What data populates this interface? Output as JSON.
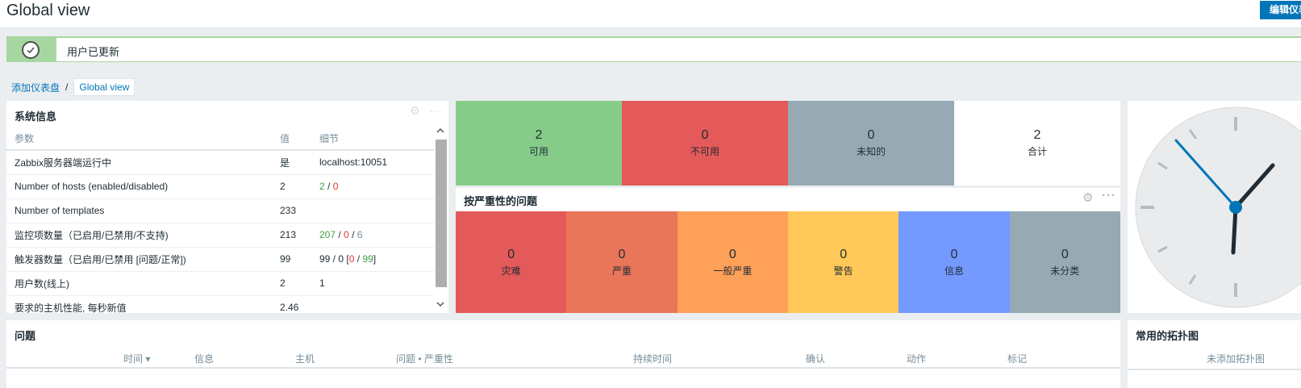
{
  "header": {
    "title": "Global view",
    "edit_button": "编辑仪表盘"
  },
  "message": {
    "text": "用户已更新",
    "icon": "check-icon"
  },
  "breadcrumb": {
    "parent": "添加仪表盘",
    "separator": "/",
    "current": "Global view"
  },
  "system_info": {
    "title": "系统信息",
    "columns": [
      "参数",
      "值",
      "细节"
    ],
    "rows": [
      {
        "param": "Zabbix服务器端运行中",
        "value": "是",
        "detail": "localhost:10051"
      },
      {
        "param": "Number of hosts (enabled/disabled)",
        "value": "2",
        "d1": "2",
        "d2": "0"
      },
      {
        "param": "Number of templates",
        "value": "233",
        "detail": ""
      },
      {
        "param": "监控项数量（已启用/已禁用/不支持)",
        "value": "213",
        "d1": "207",
        "d2": "0",
        "d3": "6"
      },
      {
        "param": "触发器数量（已启用/已禁用 [问题/正常])",
        "value": "99",
        "d_prefix": "99 / 0 [",
        "d1": "0",
        "d2": "99",
        "d_suffix": "]"
      },
      {
        "param": "用户数(线上)",
        "value": "2",
        "detail": "1"
      },
      {
        "param": "要求的主机性能, 每秒新值",
        "value": "2.46",
        "detail": ""
      }
    ]
  },
  "host_availability": {
    "cells": [
      {
        "count": "2",
        "label": "可用",
        "color": "#86cc89"
      },
      {
        "count": "0",
        "label": "不可用",
        "color": "#e45959"
      },
      {
        "count": "0",
        "label": "未知的",
        "color": "#97aab3"
      },
      {
        "count": "2",
        "label": "合计",
        "color": "#ffffff"
      }
    ]
  },
  "problems_by_severity": {
    "title": "按严重性的问题",
    "cells": [
      {
        "count": "0",
        "label": "灾难",
        "color": "#e45959"
      },
      {
        "count": "0",
        "label": "严重",
        "color": "#e97659"
      },
      {
        "count": "0",
        "label": "一般严重",
        "color": "#ffa059"
      },
      {
        "count": "0",
        "label": "警告",
        "color": "#ffc859"
      },
      {
        "count": "0",
        "label": "信息",
        "color": "#7499ff"
      },
      {
        "count": "0",
        "label": "未分类",
        "color": "#97aab3"
      }
    ]
  },
  "problems": {
    "title": "问题",
    "columns": [
      "时间 ▾",
      "信息",
      "主机",
      "问题 • 严重性",
      "持续时间",
      "确认",
      "动作",
      "标记"
    ]
  },
  "favourite_maps": {
    "title": "常用的拓扑图",
    "empty_text": "未添加拓扑图"
  }
}
